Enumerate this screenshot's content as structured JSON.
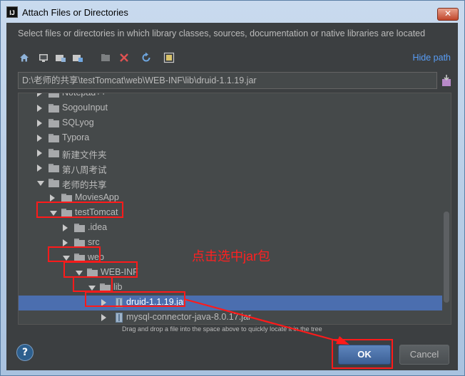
{
  "window": {
    "title": "Attach Files or Directories",
    "app_icon_text": "IJ",
    "close_glyph": "✕"
  },
  "description": "Select files or directories in which library classes, sources, documentation or native libraries are located",
  "toolbar": {
    "icons": [
      "home-icon",
      "desktop-icon",
      "project-icon",
      "module-icon",
      "new-folder-icon",
      "delete-icon",
      "refresh-icon",
      "show-hidden-icon"
    ],
    "hide_path_label": "Hide path"
  },
  "path_field": {
    "value": "D:\\老师的共享\\testTomcat\\web\\WEB-INF\\lib\\druid-1.1.19.jar"
  },
  "tree": {
    "rows": [
      {
        "label": "Notepad++",
        "kind": "folder",
        "state": "collapsed",
        "level": 0
      },
      {
        "label": "SogouInput",
        "kind": "folder",
        "state": "collapsed",
        "level": 0
      },
      {
        "label": "SQLyog",
        "kind": "folder",
        "state": "collapsed",
        "level": 0
      },
      {
        "label": "Typora",
        "kind": "folder",
        "state": "collapsed",
        "level": 0
      },
      {
        "label": "新建文件夹",
        "kind": "folder",
        "state": "collapsed",
        "level": 0
      },
      {
        "label": "第八周考试",
        "kind": "folder",
        "state": "collapsed",
        "level": 0
      },
      {
        "label": "老师的共享",
        "kind": "folder",
        "state": "expanded",
        "level": 0
      },
      {
        "label": "MoviesApp",
        "kind": "folder",
        "state": "collapsed",
        "level": 1
      },
      {
        "label": "testTomcat",
        "kind": "folder",
        "state": "expanded",
        "level": 1
      },
      {
        "label": ".idea",
        "kind": "folder",
        "state": "collapsed",
        "level": 2
      },
      {
        "label": "src",
        "kind": "folder",
        "state": "collapsed",
        "level": 2
      },
      {
        "label": "web",
        "kind": "folder",
        "state": "expanded",
        "level": 2
      },
      {
        "label": "WEB-INF",
        "kind": "folder",
        "state": "expanded",
        "level": 3
      },
      {
        "label": "lib",
        "kind": "folder",
        "state": "expanded",
        "level": 4
      },
      {
        "label": "druid-1.1.19.jar",
        "kind": "jar",
        "state": "collapsed",
        "level": 5,
        "selected": true
      },
      {
        "label": "mysql-connector-java-8.0.17.jar",
        "kind": "jar",
        "state": "collapsed",
        "level": 5
      }
    ]
  },
  "hint": "Drag and drop a file into the space above to quickly locate it in the tree",
  "annotation": "点击选中jar包",
  "buttons": {
    "help": "?",
    "ok": "OK",
    "cancel": "Cancel"
  },
  "colors": {
    "background": "#3c3f41",
    "selection": "#4b6eaf",
    "link": "#589df6",
    "annotation": "#ff1a1a"
  }
}
